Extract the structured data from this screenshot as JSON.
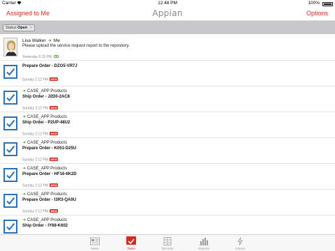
{
  "status_bar": {
    "carrier": "Carrier",
    "time": "12:48 PM",
    "battery": "100%"
  },
  "nav": {
    "left_label": "Assigned to Me",
    "logo": "Appian",
    "right_label": "Options"
  },
  "filter": {
    "label": "Status",
    "value": "Open",
    "remove": "×"
  },
  "post": {
    "author": "Lisa Walker",
    "arrow": "➜",
    "recipient": "Me",
    "text": "Please upload the service request report to the repository.",
    "time": "Yesterday 5:15 PM"
  },
  "tasks": [
    {
      "app": "",
      "title": "Prepare Order - DZO5-VR7J",
      "time": "Sunday 2:12 PM",
      "badge": "NEW"
    },
    {
      "app": "CASE_APP Products",
      "title": "Ship Order - J2D0-2AC8",
      "time": "Sunday 2:12 PM",
      "badge": "NEW"
    },
    {
      "app": "CASE_APP Products",
      "title": "Ship Order - P2UP-48U2",
      "time": "Sunday 2:12 PM",
      "badge": "NEW"
    },
    {
      "app": "CASE_APP Products",
      "title": "Prepare Order - K051-D25U",
      "time": "Sunday 2:12 PM",
      "badge": "NEW"
    },
    {
      "app": "CASE_APP Products",
      "title": "Prepare Order - HF16-6K2D",
      "time": "Sunday 2:12 PM",
      "badge": "NEW"
    },
    {
      "app": "CASE_APP Products",
      "title": "Prepare Order - I3R3-QA9U",
      "time": "Sunday 2:12 PM",
      "badge": "NEW"
    },
    {
      "app": "CASE_APP Products",
      "title": "Ship Order - IY68-K602",
      "time": "",
      "badge": ""
    }
  ],
  "tabs": [
    {
      "label": "News",
      "icon": "news-icon"
    },
    {
      "label": "Tasks",
      "icon": "tasks-icon"
    },
    {
      "label": "Records",
      "icon": "records-icon"
    },
    {
      "label": "Reports",
      "icon": "reports-icon"
    },
    {
      "label": "Actions",
      "icon": "actions-icon"
    }
  ],
  "colors": {
    "accent": "#d62a1e",
    "checkbox": "#2a6fb8",
    "link_arrow": "#3a9d23"
  }
}
